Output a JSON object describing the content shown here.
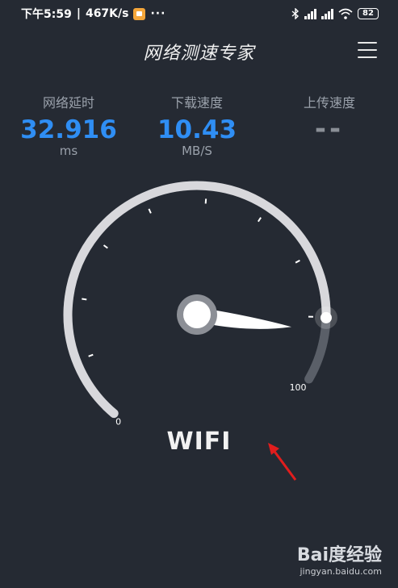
{
  "status_bar": {
    "time": "下午5:59",
    "speed": "467K/s",
    "dots": "···",
    "battery": "82"
  },
  "header": {
    "title": "网络测速专家"
  },
  "metrics": {
    "latency": {
      "label": "网络延时",
      "value": "32.916",
      "unit": "ms"
    },
    "download": {
      "label": "下载速度",
      "value": "10.43",
      "unit": "MB/S"
    },
    "upload": {
      "label": "上传速度",
      "value": "--"
    }
  },
  "gauge": {
    "min_label": "0",
    "max_label": "100",
    "max_value": 100,
    "current_value": 89,
    "track_color": "#5a5f68",
    "fill_color": "#d8d8dc"
  },
  "network_type": "WIFI",
  "watermark": {
    "main": "Bai度经验",
    "sub": "jingyan.baidu.com"
  },
  "colors": {
    "accent": "#2f8ef4",
    "background": "#252a33",
    "annotation_arrow": "#e11d1d"
  }
}
